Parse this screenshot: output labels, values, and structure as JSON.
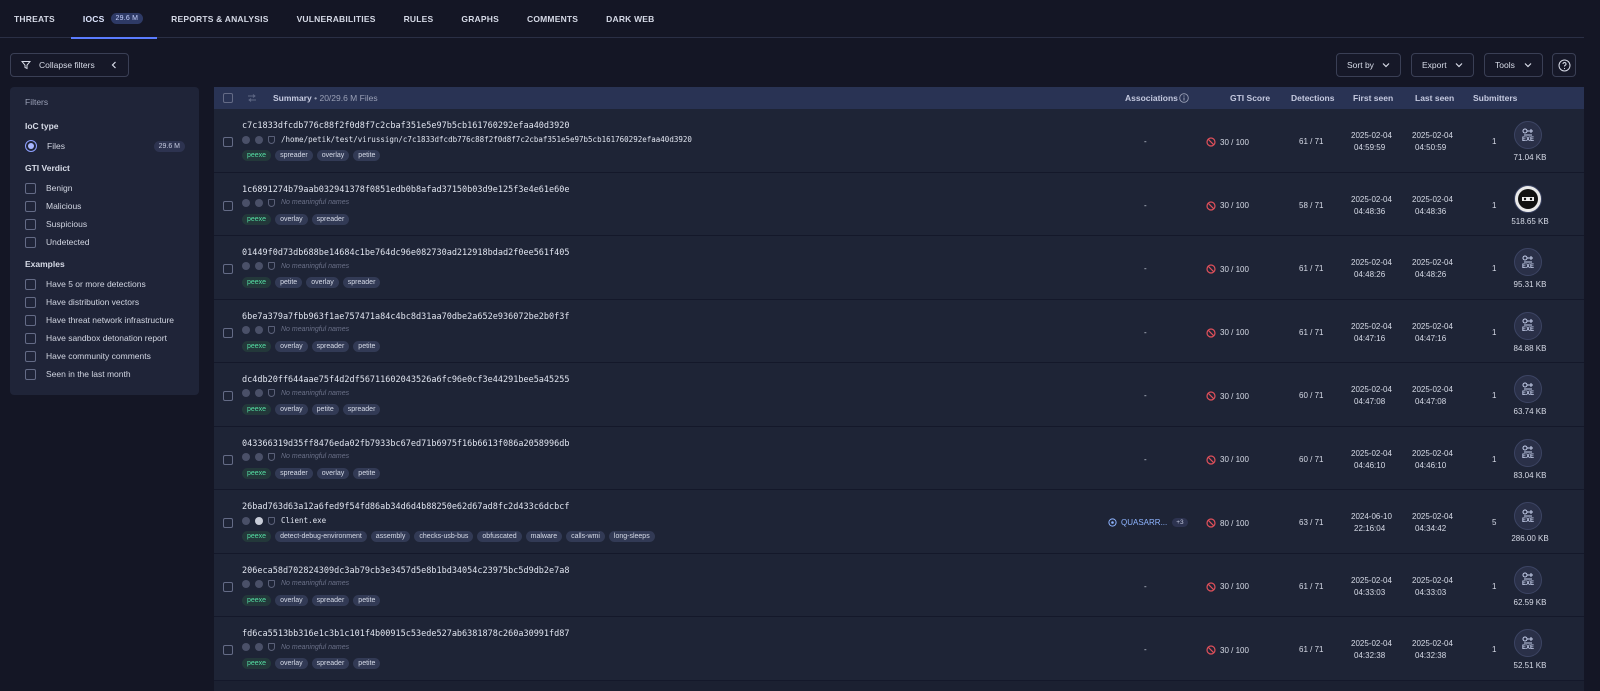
{
  "tabs": [
    {
      "label": "THREATS"
    },
    {
      "label": "IOCS",
      "badge": "29.6 M"
    },
    {
      "label": "REPORTS & ANALYSIS"
    },
    {
      "label": "VULNERABILITIES"
    },
    {
      "label": "RULES"
    },
    {
      "label": "GRAPHS"
    },
    {
      "label": "COMMENTS"
    },
    {
      "label": "DARK WEB"
    }
  ],
  "toolbar": {
    "collapse": "Collapse filters",
    "sort": "Sort by",
    "export": "Export",
    "tools": "Tools"
  },
  "filters": {
    "title": "Filters",
    "ioc_type": "IoC type",
    "files_label": "Files",
    "files_count": "29.6 M",
    "gti_verdict": "GTI Verdict",
    "verdicts": [
      "Benign",
      "Malicious",
      "Suspicious",
      "Undetected"
    ],
    "examples_title": "Examples",
    "examples": [
      "Have 5 or more detections",
      "Have distribution vectors",
      "Have threat network infrastructure",
      "Have sandbox detonation report",
      "Have community comments",
      "Seen in the last month"
    ]
  },
  "table": {
    "summary": "Summary",
    "summary_count": "• 20/29.6 M Files",
    "associations": "Associations",
    "gti_score": "GTI Score",
    "detections": "Detections",
    "first_seen": "First seen",
    "last_seen": "Last seen",
    "submitters": "Submitters",
    "no_names": "No meaningful names",
    "rows": [
      {
        "hash": "c7c1833dfcdb776c88f2f0d8f7c2cbaf351e5e97b5cb161760292efaa40d3920",
        "name": "/home/petik/test/virussign/c7c1833dfcdb776c88f2f0d8f7c2cbaf351e5e97b5cb161760292efaa40d3920",
        "tags": [
          "peexe",
          "spreader",
          "overlay",
          "petite"
        ],
        "assoc": "-",
        "gti": "30 / 100",
        "det": "61 / 71",
        "first_d": "2025-02-04",
        "first_t": "04:59:59",
        "last_d": "2025-02-04",
        "last_t": "04:50:59",
        "subs": "1",
        "size": "71.04 KB",
        "ft": "EXE"
      },
      {
        "hash": "1c6891274b79aab032941378f0851edb0b8afad37150b03d9e125f3e4e61e60e",
        "name": "",
        "tags": [
          "peexe",
          "overlay",
          "spreader"
        ],
        "assoc": "-",
        "gti": "30 / 100",
        "det": "58 / 71",
        "first_d": "2025-02-04",
        "first_t": "04:48:36",
        "last_d": "2025-02-04",
        "last_t": "04:48:36",
        "subs": "1",
        "size": "518.65 KB",
        "ft": "AV"
      },
      {
        "hash": "01449f0d73db688be14684c1be764dc96e082730ad212918bdad2f0ee561f405",
        "name": "",
        "tags": [
          "peexe",
          "petite",
          "overlay",
          "spreader"
        ],
        "assoc": "-",
        "gti": "30 / 100",
        "det": "61 / 71",
        "first_d": "2025-02-04",
        "first_t": "04:48:26",
        "last_d": "2025-02-04",
        "last_t": "04:48:26",
        "subs": "1",
        "size": "95.31 KB",
        "ft": "EXE"
      },
      {
        "hash": "6be7a379a7fbb963f1ae757471a84c4bc8d31aa70dbe2a652e936072be2b0f3f",
        "name": "",
        "tags": [
          "peexe",
          "overlay",
          "spreader",
          "petite"
        ],
        "assoc": "-",
        "gti": "30 / 100",
        "det": "61 / 71",
        "first_d": "2025-02-04",
        "first_t": "04:47:16",
        "last_d": "2025-02-04",
        "last_t": "04:47:16",
        "subs": "1",
        "size": "84.88 KB",
        "ft": "EXE"
      },
      {
        "hash": "dc4db20ff644aae75f4d2df56711602043526a6fc96e0cf3e44291bee5a45255",
        "name": "",
        "tags": [
          "peexe",
          "overlay",
          "petite",
          "spreader"
        ],
        "assoc": "-",
        "gti": "30 / 100",
        "det": "60 / 71",
        "first_d": "2025-02-04",
        "first_t": "04:47:08",
        "last_d": "2025-02-04",
        "last_t": "04:47:08",
        "subs": "1",
        "size": "63.74 KB",
        "ft": "EXE"
      },
      {
        "hash": "043366319d35ff8476eda02fb7933bc67ed71b6975f16b6613f086a2058996db",
        "name": "",
        "tags": [
          "peexe",
          "spreader",
          "overlay",
          "petite"
        ],
        "assoc": "-",
        "gti": "30 / 100",
        "det": "60 / 71",
        "first_d": "2025-02-04",
        "first_t": "04:46:10",
        "last_d": "2025-02-04",
        "last_t": "04:46:10",
        "subs": "1",
        "size": "83.04 KB",
        "ft": "EXE"
      },
      {
        "hash": "26bad763d63a12a6fed9f54fd86ab34d6d4b88250e62d67ad8fc2d433c6dcbcf",
        "name": "Client.exe",
        "tags": [
          "peexe",
          "detect-debug-environment",
          "assembly",
          "checks-usb-bus",
          "obfuscated",
          "malware",
          "calls-wmi",
          "long-sleeps"
        ],
        "assoc": "QUASARR...",
        "assoc_more": "+3",
        "gti": "80 / 100",
        "det": "63 / 71",
        "first_d": "2024-06-10",
        "first_t": "22:16:04",
        "last_d": "2025-02-04",
        "last_t": "04:34:42",
        "subs": "5",
        "size": "286.00 KB",
        "ft": "EXE"
      },
      {
        "hash": "206eca58d702824309dc3ab79cb3e3457d5e8b1bd34054c23975bc5d9db2e7a8",
        "name": "",
        "tags": [
          "peexe",
          "overlay",
          "spreader",
          "petite"
        ],
        "assoc": "-",
        "gti": "30 / 100",
        "det": "61 / 71",
        "first_d": "2025-02-04",
        "first_t": "04:33:03",
        "last_d": "2025-02-04",
        "last_t": "04:33:03",
        "subs": "1",
        "size": "62.59 KB",
        "ft": "EXE"
      },
      {
        "hash": "fd6ca5513bb316e1c3b1c101f4b00915c53ede527ab6381878c260a30991fd87",
        "name": "",
        "tags": [
          "peexe",
          "overlay",
          "spreader",
          "petite"
        ],
        "assoc": "-",
        "gti": "30 / 100",
        "det": "61 / 71",
        "first_d": "2025-02-04",
        "first_t": "04:32:38",
        "last_d": "2025-02-04",
        "last_t": "04:32:38",
        "subs": "1",
        "size": "52.51 KB",
        "ft": "EXE"
      }
    ]
  }
}
